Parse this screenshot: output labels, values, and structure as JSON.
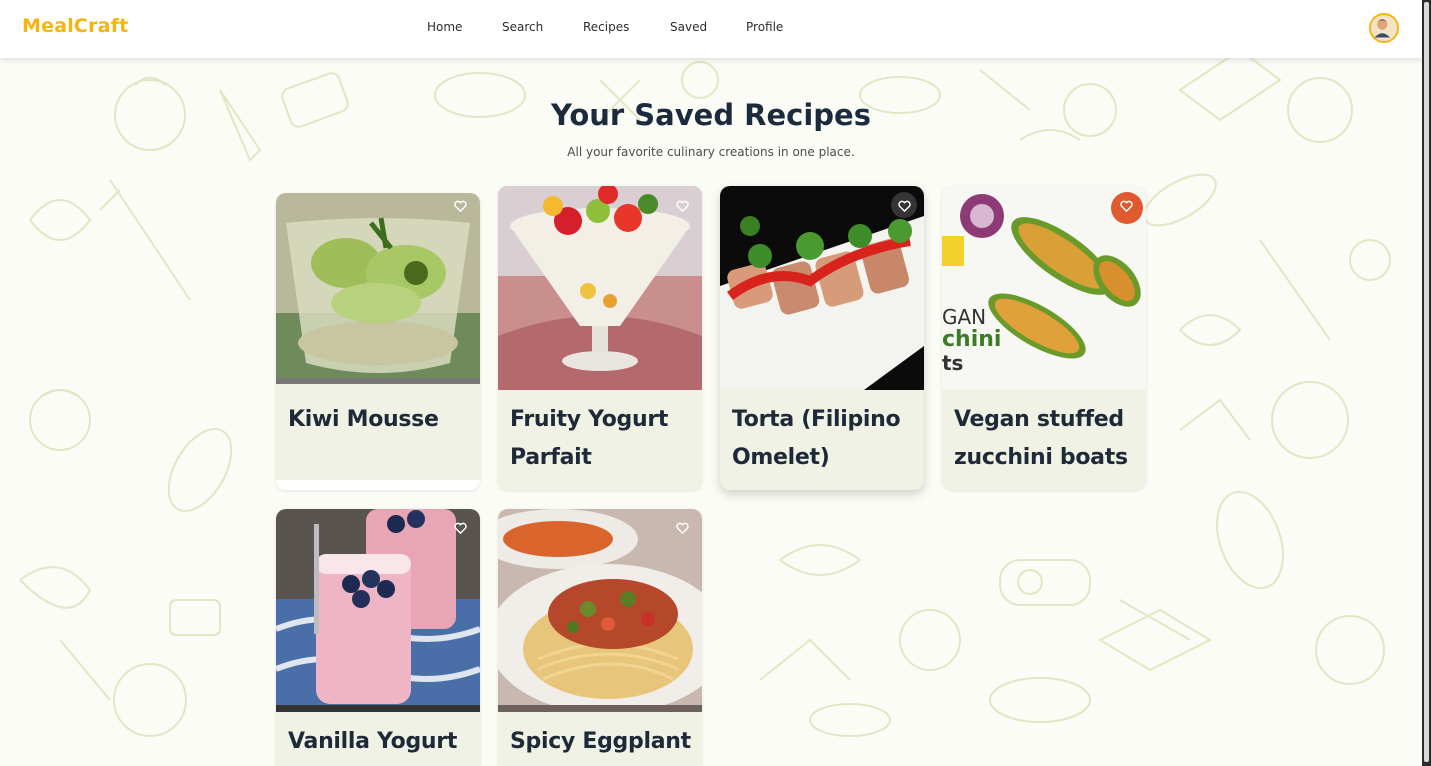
{
  "app": {
    "brand": "MealCraft"
  },
  "nav": {
    "items": [
      {
        "label": "Home"
      },
      {
        "label": "Search"
      },
      {
        "label": "Recipes"
      },
      {
        "label": "Saved"
      },
      {
        "label": "Profile"
      }
    ]
  },
  "header": {
    "title": "Your Saved Recipes",
    "subtitle": "All your favorite culinary creations in one place."
  },
  "recipes": [
    {
      "title": "Kiwi Mousse",
      "saved": true
    },
    {
      "title": "Fruity Yogurt Parfait",
      "saved": true
    },
    {
      "title": "Torta (Filipino Omelet)",
      "saved": true
    },
    {
      "title": "Vegan stuffed zucchini boats",
      "saved": true
    },
    {
      "title": "Vanilla Yogurt",
      "saved": true
    },
    {
      "title": "Spicy Eggplant",
      "saved": true
    }
  ],
  "icons": {
    "favorite": "heart-icon",
    "avatar": "user-avatar-icon"
  },
  "colors": {
    "brand": "#f5b50f",
    "title": "#1b2a3d",
    "card_bg": "#f1f2e6",
    "doodle": "#dfe8c4"
  }
}
